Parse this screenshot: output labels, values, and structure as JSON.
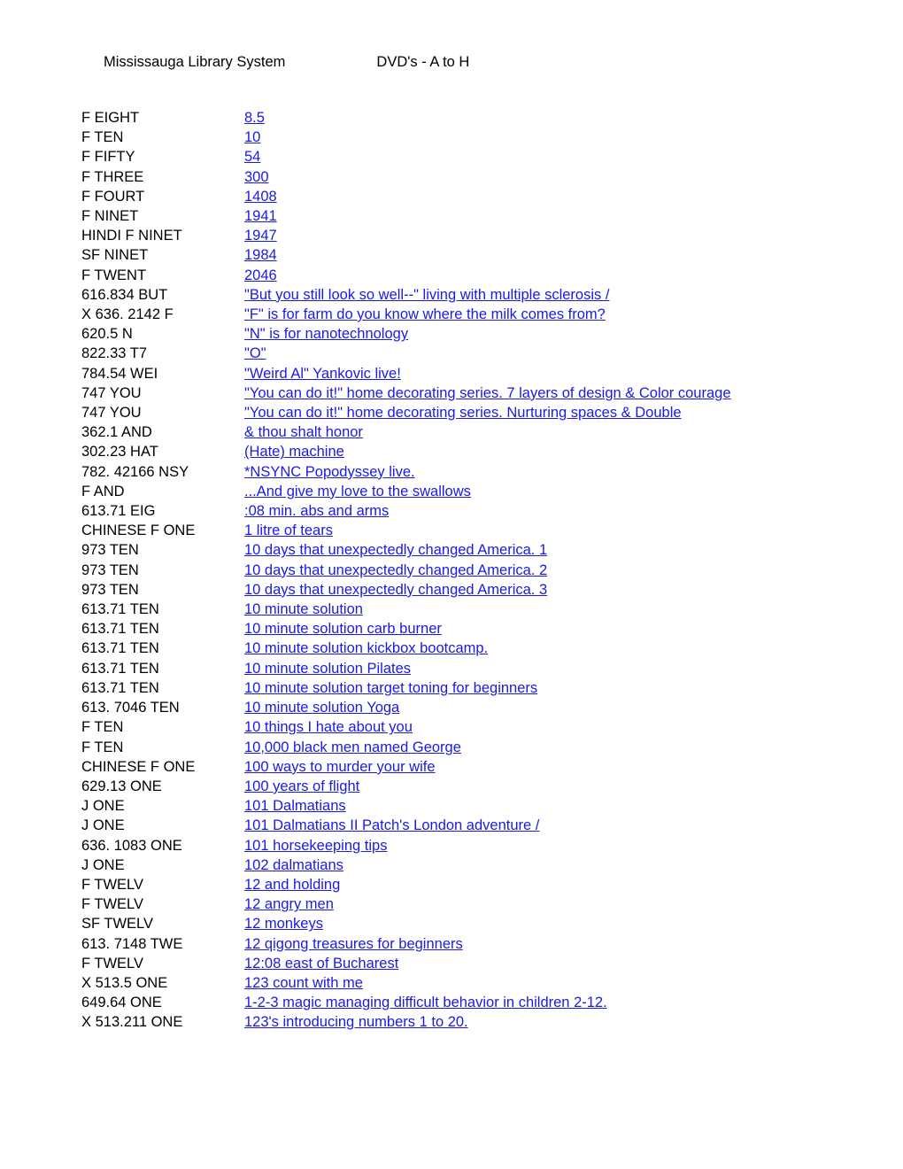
{
  "header": {
    "library_name": "Mississauga Library System",
    "list_title": "DVD's - A to H"
  },
  "columns": {
    "call_number_header": "",
    "title_header": ""
  },
  "colors": {
    "link": "#1a1ae6",
    "text": "#000000",
    "background": "#ffffff"
  },
  "rows": [
    {
      "call": "F EIGHT",
      "title": "8.5",
      "wrapped": false
    },
    {
      "call": "F TEN",
      "title": "10",
      "wrapped": false
    },
    {
      "call": "F FIFTY",
      "title": "54",
      "wrapped": false
    },
    {
      "call": "F THREE",
      "title": "300",
      "wrapped": false
    },
    {
      "call": "F FOURT",
      "title": "1408",
      "wrapped": false
    },
    {
      "call": "F NINET",
      "title": "1941",
      "wrapped": false
    },
    {
      "call": "HINDI F NINET",
      "title": "1947",
      "wrapped": false
    },
    {
      "call": "SF NINET",
      "title": "1984",
      "wrapped": false
    },
    {
      "call": "F TWENT",
      "title": "2046",
      "wrapped": false
    },
    {
      "call": "616.834 BUT",
      "title": "\"But you still look so well--\" living with multiple sclerosis /",
      "wrapped": false
    },
    {
      "call": "X 636. 2142 F",
      "title": "\"F\" is for farm do you know where the milk comes from?",
      "wrapped": false
    },
    {
      "call": "620.5 N",
      "title": "\"N\" is for nanotechnology",
      "wrapped": false
    },
    {
      "call": "822.33 T7",
      "title": "\"O\"",
      "wrapped": false
    },
    {
      "call": "784.54 WEI",
      "title": "\"Weird Al\" Yankovic live!",
      "wrapped": false
    },
    {
      "call": "747 YOU",
      "title": "\"You can do it!\" home decorating series. 7 layers of design & Color courage",
      "wrapped": true
    },
    {
      "call": "747 YOU",
      "title": "\"You can do it!\" home decorating series. Nurturing spaces & Double",
      "wrapped": false
    },
    {
      "call": "362.1 AND",
      "title": "& thou shalt honor",
      "wrapped": false
    },
    {
      "call": "302.23 HAT",
      "title": "(Hate) machine",
      "wrapped": false
    },
    {
      "call": "782. 42166 NSY",
      "title": "*NSYNC Popodyssey live.",
      "wrapped": false
    },
    {
      "call": "F AND",
      "title": "...And give my love to the swallows",
      "wrapped": false
    },
    {
      "call": "613.71 EIG",
      "title": ":08 min. abs and arms",
      "wrapped": false
    },
    {
      "call": "CHINESE F ONE",
      "title": "1 litre of tears",
      "wrapped": false
    },
    {
      "call": "973 TEN",
      "title": "10 days that unexpectedly changed America. 1",
      "wrapped": false
    },
    {
      "call": "973 TEN",
      "title": "10 days that unexpectedly changed America. 2",
      "wrapped": false
    },
    {
      "call": "973 TEN",
      "title": "10 days that unexpectedly changed America. 3",
      "wrapped": false
    },
    {
      "call": "613.71 TEN",
      "title": "10 minute solution",
      "wrapped": false
    },
    {
      "call": "613.71 TEN",
      "title": "10 minute solution carb burner",
      "wrapped": false
    },
    {
      "call": "613.71 TEN",
      "title": "10 minute solution kickbox bootcamp.",
      "wrapped": false
    },
    {
      "call": "613.71 TEN",
      "title": "10 minute solution Pilates",
      "wrapped": false
    },
    {
      "call": "613.71 TEN",
      "title": "10 minute solution target toning for beginners",
      "wrapped": false
    },
    {
      "call": "613. 7046 TEN",
      "title": "10 minute solution Yoga",
      "wrapped": false
    },
    {
      "call": "F TEN",
      "title": "10 things I hate about you",
      "wrapped": false
    },
    {
      "call": "F TEN",
      "title": "10,000 black men named George",
      "wrapped": false
    },
    {
      "call": "CHINESE F ONE",
      "title": "100 ways to murder your wife",
      "wrapped": false
    },
    {
      "call": "629.13 ONE",
      "title": "100 years of flight",
      "wrapped": false
    },
    {
      "call": "J ONE",
      "title": "101 Dalmatians",
      "wrapped": false
    },
    {
      "call": "J ONE",
      "title": "101 Dalmatians II Patch's London adventure /",
      "wrapped": false
    },
    {
      "call": "636. 1083 ONE",
      "title": "101 horsekeeping tips",
      "wrapped": false
    },
    {
      "call": "J ONE",
      "title": "102 dalmatians",
      "wrapped": false
    },
    {
      "call": "F TWELV",
      "title": "12 and holding",
      "wrapped": false
    },
    {
      "call": "F TWELV",
      "title": "12 angry men",
      "wrapped": false
    },
    {
      "call": "SF TWELV",
      "title": "12 monkeys",
      "wrapped": false
    },
    {
      "call": "613. 7148 TWE",
      "title": "12 qigong treasures for beginners",
      "wrapped": false
    },
    {
      "call": "F TWELV",
      "title": "12:08 east of Bucharest",
      "wrapped": false
    },
    {
      "call": "X 513.5 ONE",
      "title": "123 count with me",
      "wrapped": false
    },
    {
      "call": "649.64 ONE",
      "title": "1-2-3 magic managing difficult behavior in children 2-12.",
      "wrapped": false
    },
    {
      "call": "X 513.211 ONE",
      "title": "123's introducing numbers 1 to 20.",
      "wrapped": false
    }
  ]
}
